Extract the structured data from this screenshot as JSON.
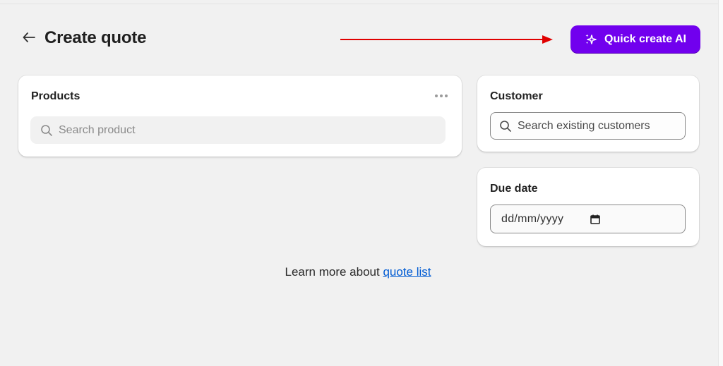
{
  "header": {
    "title": "Create quote",
    "ai_button_label": "Quick create AI"
  },
  "products": {
    "title": "Products",
    "search_placeholder": "Search product"
  },
  "customer": {
    "title": "Customer",
    "search_placeholder": "Search existing customers"
  },
  "due_date": {
    "title": "Due date",
    "value": "dd/mm/yyyy"
  },
  "footer": {
    "prefix": "Learn more about",
    "link": "quote list"
  },
  "colors": {
    "accent": "#7100ee",
    "link": "#005bd3",
    "annotation_arrow": "#e00000"
  }
}
